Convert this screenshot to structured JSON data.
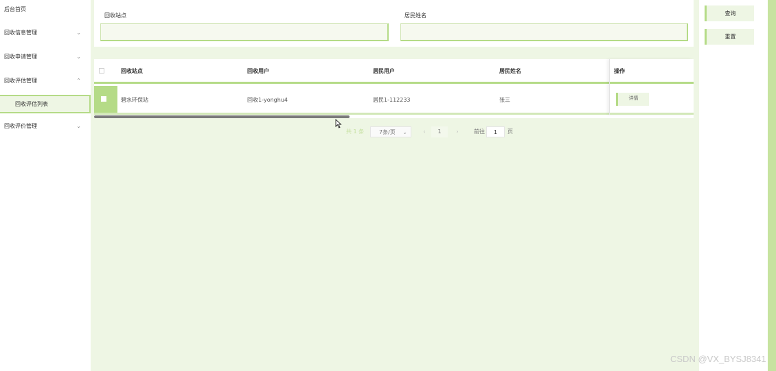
{
  "sidebar": {
    "items": [
      {
        "label": "后台首页"
      },
      {
        "label": "回收信息管理",
        "chevron": "⌄"
      },
      {
        "label": "回收申请管理",
        "chevron": "⌄"
      },
      {
        "label": "回收评估管理",
        "chevron": "⌃"
      },
      {
        "label": "回收评价管理",
        "chevron": "⌄"
      }
    ],
    "sub_active": "回收评估列表"
  },
  "search": {
    "station_label": "回收站点",
    "station_value": "",
    "resident_name_label": "居民姓名",
    "resident_name_value": ""
  },
  "actions": {
    "query_label": "查询",
    "reset_label": "重置"
  },
  "table": {
    "columns": [
      "回收站点",
      "回收用户",
      "居民用户",
      "居民姓名",
      "操作"
    ],
    "rows": [
      {
        "station": "碧水环保站",
        "recycle_user": "回收1-yonghu4",
        "resident_user": "居民1-112233",
        "resident_name": "张三",
        "action": "详情"
      }
    ]
  },
  "pagination": {
    "total": "共 1 条",
    "page_size": "7条/页",
    "current_page": "1",
    "prev": "‹",
    "next": "›",
    "goto_label": "前往",
    "goto_value": "1",
    "page_suffix": "页"
  },
  "watermark": "CSDN @VX_BYSJ8341",
  "colors": {
    "accent": "#b5db87",
    "main_bg": "#eef6e4",
    "right_bar": "#c7e3a0"
  }
}
